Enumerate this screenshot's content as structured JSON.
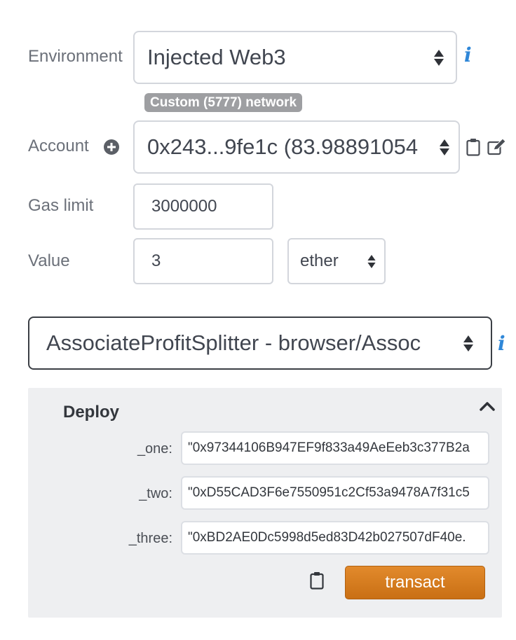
{
  "environment": {
    "label": "Environment",
    "selected": "Injected Web3",
    "network_badge": "Custom (5777) network"
  },
  "account": {
    "label": "Account",
    "selected": "0x243...9fe1c (83.98891054"
  },
  "gas_limit": {
    "label": "Gas limit",
    "value": "3000000"
  },
  "value": {
    "label": "Value",
    "amount": "3",
    "unit": "ether"
  },
  "contract": {
    "selected": "AssociateProfitSplitter - browser/Assoc"
  },
  "deploy": {
    "title": "Deploy",
    "params": [
      {
        "label": "_one:",
        "value": "\"0x97344106B947EF9f833a49AeEeb3c377B2a"
      },
      {
        "label": "_two:",
        "value": "\"0xD55CAD3F6e7550951c2Cf53a9478A7f31c5"
      },
      {
        "label": "_three:",
        "value": "\"0xBD2AE0Dc5998d5ed83D42b027507dF40e."
      }
    ],
    "transact_label": "transact"
  },
  "icons": {
    "info": "i",
    "add_account": "plus-circle-icon",
    "copy": "clipboard-icon",
    "edit": "edit-icon",
    "collapse": "chevron-up-icon"
  },
  "colors": {
    "info_blue": "#2f87d8",
    "transact_orange": "#d57b1f",
    "badge_gray": "#9e9fa2",
    "panel_bg": "#eeeff1"
  }
}
